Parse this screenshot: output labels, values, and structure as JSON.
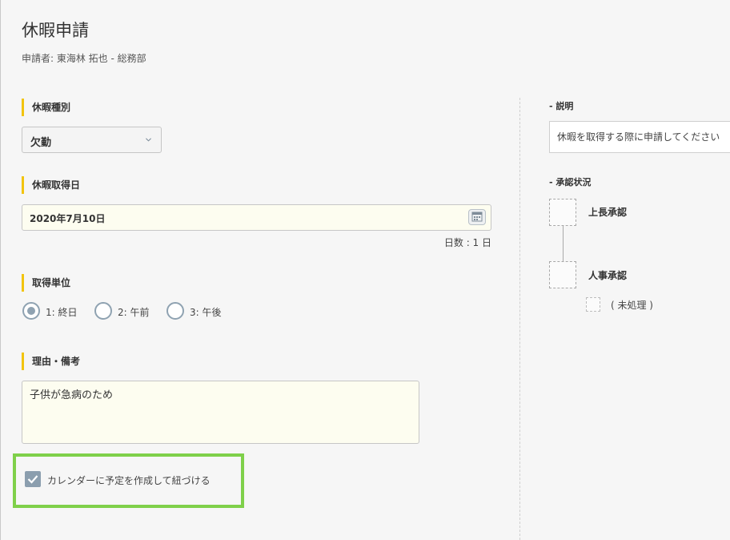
{
  "page": {
    "title": "休暇申請",
    "applicant": "申請者:  東海林 拓也 - 総務部"
  },
  "leave_type": {
    "label": "休暇種別",
    "value": "欠勤"
  },
  "leave_date": {
    "label": "休暇取得日",
    "value": "2020年7月10日",
    "days": "日数 : 1 日"
  },
  "unit": {
    "label": "取得単位",
    "options": [
      {
        "label": "1: 終日",
        "selected": true
      },
      {
        "label": "2: 午前",
        "selected": false
      },
      {
        "label": "3: 午後",
        "selected": false
      }
    ]
  },
  "reason": {
    "label": "理由・備考",
    "value": "子供が急病のため"
  },
  "calendar_link": {
    "label": "カレンダーに予定を作成して紐づける",
    "checked": true
  },
  "description": {
    "label": "- 説明",
    "text": "休暇を取得する際に申請してください"
  },
  "approval": {
    "label": "- 承認状況",
    "steps": [
      {
        "name": "上長承認"
      },
      {
        "name": "人事承認",
        "status": "( 未処理 )"
      }
    ]
  },
  "colors": {
    "accent": "#f2c40f",
    "highlight": "#7fd04a",
    "control": "#8fa2b1",
    "input_bg": "#fdfdf0"
  }
}
